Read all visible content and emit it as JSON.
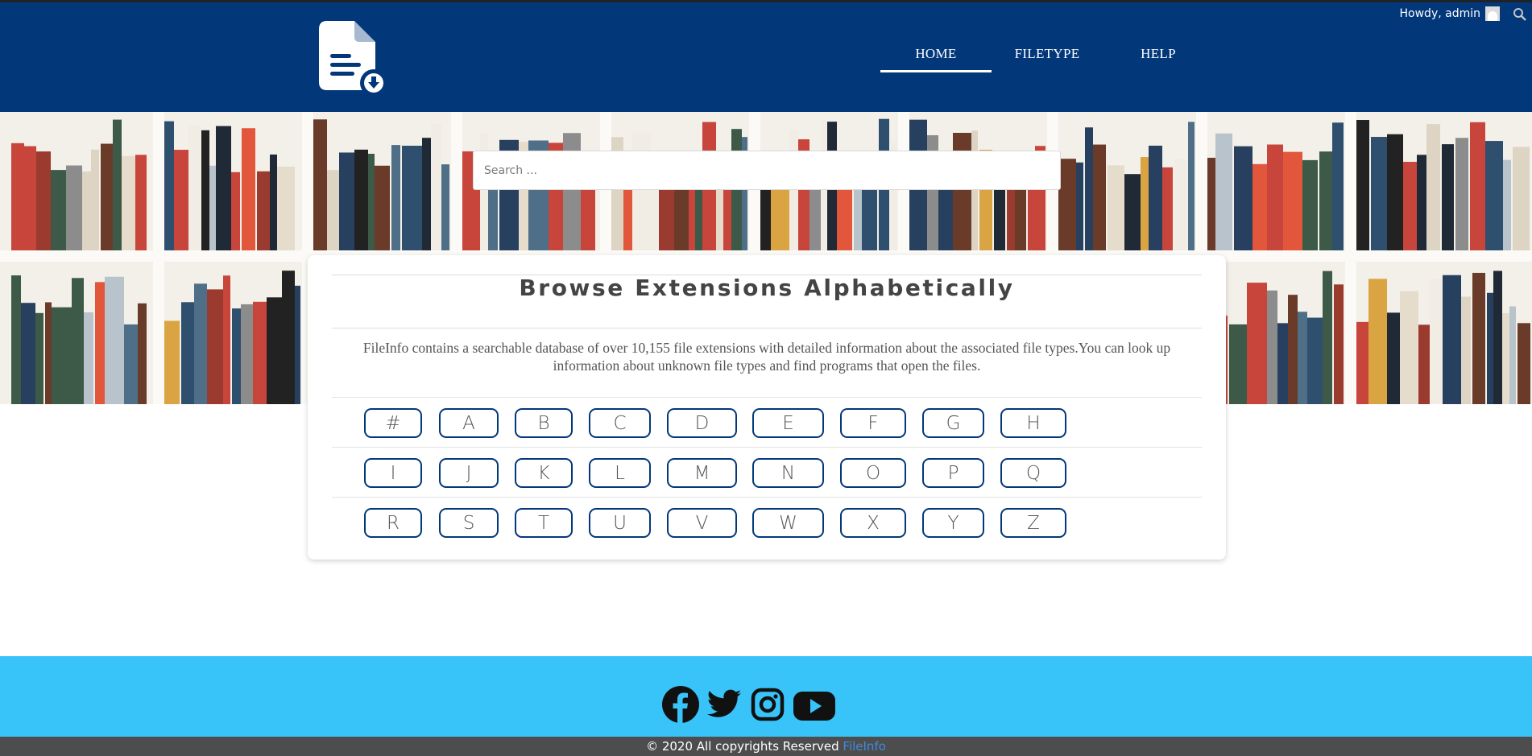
{
  "header": {
    "logo_icon": "file-download-icon",
    "howdy": "Howdy, admin",
    "nav": [
      {
        "label": "HOME",
        "active": true
      },
      {
        "label": "FILETYPE",
        "active": false
      },
      {
        "label": "HELP",
        "active": false
      }
    ]
  },
  "search": {
    "placeholder": "Search ...",
    "value": ""
  },
  "browse": {
    "title": "Browse Extensions Alphabetically",
    "description": "FileInfo contains a searchable database of over 10,155 file extensions with detailed information about the associated file types.You can look up information about unknown file types and find programs that open the files.",
    "rows": [
      [
        "#",
        "A",
        "B",
        "C",
        "D",
        "E",
        "F",
        "G",
        "H"
      ],
      [
        "I",
        "J",
        "K",
        "L",
        "M",
        "N",
        "O",
        "P",
        "Q"
      ],
      [
        "R",
        "S",
        "T",
        "U",
        "V",
        "W",
        "X",
        "Y",
        "Z"
      ]
    ]
  },
  "footer": {
    "social": [
      "facebook-icon",
      "twitter-icon",
      "instagram-icon",
      "youtube-icon"
    ],
    "copyright": "© 2020 All copyrights Reserved",
    "brand": "FileInfo"
  },
  "colors": {
    "header": "#02377a",
    "social_bar": "#39c4f9",
    "copyright_bar": "#4d4d4d",
    "button_border": "#02377a"
  }
}
